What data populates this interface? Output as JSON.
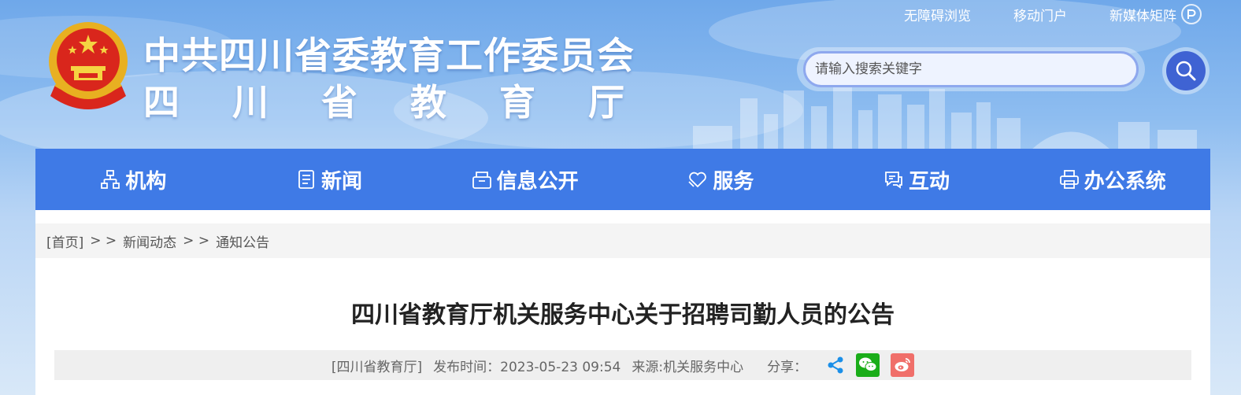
{
  "top_links": [
    "无障碍浏览",
    "移动门户",
    "新媒体矩阵"
  ],
  "header": {
    "title": "中共四川省委教育工作委员会",
    "subtitle": "四川省教育厅"
  },
  "search": {
    "placeholder": "请输入搜索关键字"
  },
  "nav": [
    {
      "label": "机构",
      "icon": "org-chart-icon"
    },
    {
      "label": "新闻",
      "icon": "news-icon"
    },
    {
      "label": "信息公开",
      "icon": "info-open-icon"
    },
    {
      "label": "服务",
      "icon": "heart-hand-icon"
    },
    {
      "label": "互动",
      "icon": "chat-icon"
    },
    {
      "label": "办公系统",
      "icon": "printer-icon"
    }
  ],
  "breadcrumb": {
    "home": "[首页]",
    "sep": "> >",
    "level1": "新闻动态",
    "level2": "通知公告"
  },
  "article": {
    "title": "四川省教育厅机关服务中心关于招聘司勤人员的公告",
    "source_tag": "[四川省教育厅]",
    "publish_time": "发布时间：2023-05-23 09:54",
    "source": "来源:机关服务中心",
    "share_label": "分享："
  },
  "colors": {
    "nav_bg": "#3f7ae6",
    "search_btn": "#3f63d3",
    "wechat": "#1aad19",
    "weibo": "#f06f6a",
    "share": "#1b8fe8"
  }
}
